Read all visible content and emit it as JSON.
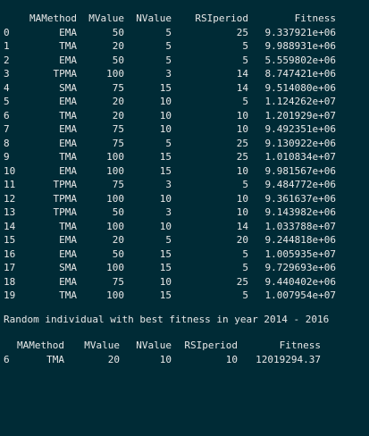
{
  "table1": {
    "headers": [
      "MAMethod",
      "MValue",
      "NValue",
      "RSIperiod",
      "Fitness"
    ],
    "rows": [
      [
        "0",
        "EMA",
        "50",
        "5",
        "25",
        "9.337921e+06"
      ],
      [
        "1",
        "TMA",
        "20",
        "5",
        "5",
        "9.988931e+06"
      ],
      [
        "2",
        "EMA",
        "50",
        "5",
        "5",
        "5.559802e+06"
      ],
      [
        "3",
        "TPMA",
        "100",
        "3",
        "14",
        "8.747421e+06"
      ],
      [
        "4",
        "SMA",
        "75",
        "15",
        "14",
        "9.514080e+06"
      ],
      [
        "5",
        "EMA",
        "20",
        "10",
        "5",
        "1.124262e+07"
      ],
      [
        "6",
        "TMA",
        "20",
        "10",
        "10",
        "1.201929e+07"
      ],
      [
        "7",
        "EMA",
        "75",
        "10",
        "10",
        "9.492351e+06"
      ],
      [
        "8",
        "EMA",
        "75",
        "5",
        "25",
        "9.130922e+06"
      ],
      [
        "9",
        "TMA",
        "100",
        "15",
        "25",
        "1.010834e+07"
      ],
      [
        "10",
        "EMA",
        "100",
        "15",
        "10",
        "9.981567e+06"
      ],
      [
        "11",
        "TPMA",
        "75",
        "3",
        "5",
        "9.484772e+06"
      ],
      [
        "12",
        "TPMA",
        "100",
        "10",
        "10",
        "9.361637e+06"
      ],
      [
        "13",
        "TPMA",
        "50",
        "3",
        "10",
        "9.143982e+06"
      ],
      [
        "14",
        "TMA",
        "100",
        "10",
        "14",
        "1.033788e+07"
      ],
      [
        "15",
        "EMA",
        "20",
        "5",
        "20",
        "9.244818e+06"
      ],
      [
        "16",
        "EMA",
        "50",
        "15",
        "5",
        "1.005935e+07"
      ],
      [
        "17",
        "SMA",
        "100",
        "15",
        "5",
        "9.729693e+06"
      ],
      [
        "18",
        "EMA",
        "75",
        "10",
        "25",
        "9.440402e+06"
      ],
      [
        "19",
        "TMA",
        "100",
        "15",
        "5",
        "1.007954e+07"
      ]
    ]
  },
  "message": "Random individual with best fitness in year 2014 - 2016",
  "table2": {
    "headers": [
      "MAMethod",
      "MValue",
      "NValue",
      "RSIperiod",
      "Fitness"
    ],
    "rows": [
      [
        "6",
        "TMA",
        "20",
        "10",
        "10",
        "12019294.37"
      ]
    ]
  },
  "colors": {
    "background": "#002b36",
    "text": "#e8e8e8"
  }
}
